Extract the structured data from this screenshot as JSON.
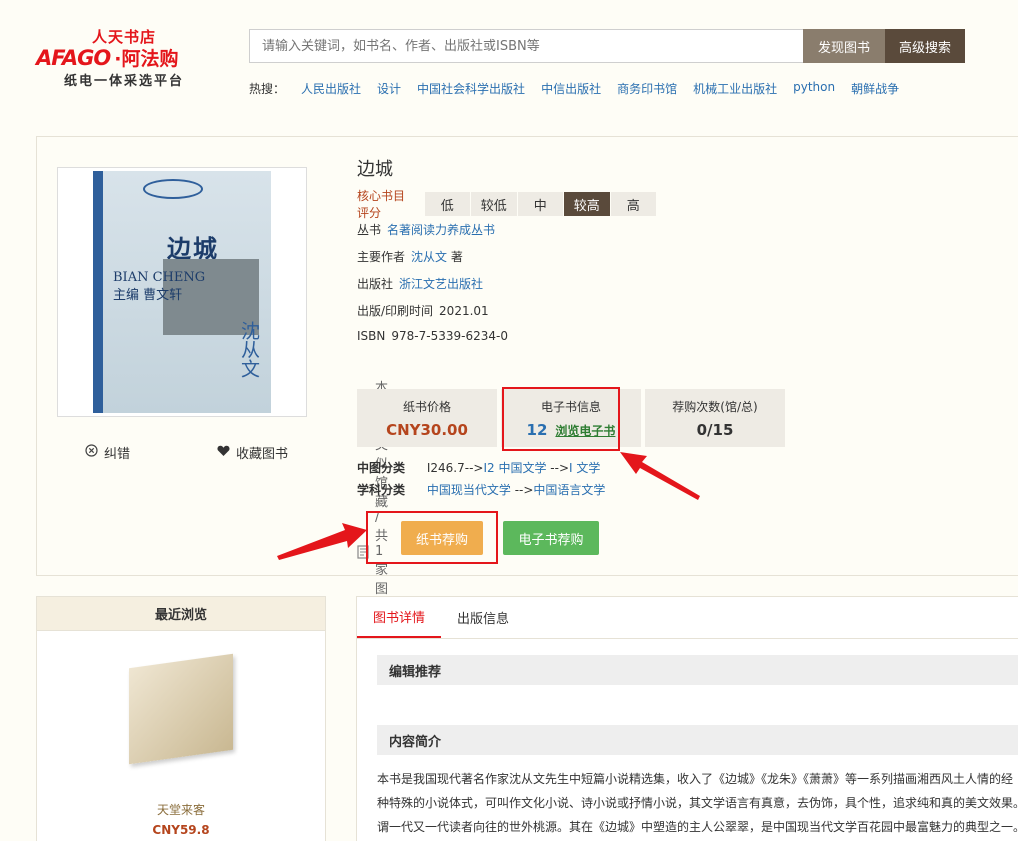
{
  "logo": {
    "store": "人天书店",
    "brand": "AFAGO",
    "brand_cn": "·阿法购",
    "slogan": "纸电一体采选平台"
  },
  "search": {
    "placeholder": "请输入关键词，如书名、作者、出版社或ISBN等",
    "find_label": "发现图书",
    "advanced_label": "高级搜索"
  },
  "hot": {
    "label": "热搜：",
    "items": [
      "人民出版社",
      "设计",
      "中国社会科学出版社",
      "中信出版社",
      "商务印书馆",
      "机械工业出版社",
      "python",
      "朝鲜战争"
    ]
  },
  "book": {
    "title": "边城",
    "rating_label": "核心书目评分",
    "rating_options": [
      "低",
      "较低",
      "中",
      "较高",
      "高"
    ],
    "rating_selected": "较高",
    "series_label": "丛书",
    "series": "名著阅读力养成丛书",
    "author_label": "主要作者",
    "author": "沈从文",
    "author_role": "著",
    "publisher_label": "出版社",
    "publisher": "浙江文艺出版社",
    "date_label": "出版/印刷时间",
    "date": "2021.01",
    "isbn_label": "ISBN",
    "isbn": "978-7-5339-6234-0",
    "holding_text": "本馆无类似馆藏 / 共1家图书馆有类似馆藏",
    "cover": {
      "title": "边城",
      "sub": "BIAN CHENG",
      "editor": "主编 曹文轩",
      "author": "沈从文"
    }
  },
  "actions": {
    "report": "纠错",
    "favorite": "收藏图书"
  },
  "stats": {
    "paper_price_label": "纸书价格",
    "paper_price": "CNY30.00",
    "ebook_label": "电子书信息",
    "ebook_count": "12",
    "ebook_link": "浏览电子书",
    "order_label": "荐购次数(馆/总)",
    "order_value": "0/15"
  },
  "classification": {
    "clc_label": "中图分类",
    "clc": [
      "I246.7-->",
      "I2 中国文学",
      "-->",
      "I 文学"
    ],
    "subject_label": "学科分类",
    "subject": [
      "中国现当代文学",
      "-->",
      "中国语言文学"
    ]
  },
  "buttons": {
    "paper_order": "纸书荐购",
    "ebook_order": "电子书荐购"
  },
  "recent": {
    "title": "最近浏览",
    "item_name": "天堂来客",
    "item_price": "CNY59.8"
  },
  "details": {
    "tabs": [
      "图书详情",
      "出版信息"
    ],
    "editor_rec": "编辑推荐",
    "summary_title": "内容简介",
    "summary_lines": [
      "本书是我国现代著名作家沈从文先生中短篇小说精选集，收入了《边城》《龙朱》《萧萧》等一系列描画湘西风土人情的经",
      "种特殊的小说体式，可叫作文化小说、诗小说或抒情小说，其文学语言有真意，去伪饰，具个性，追求纯和真的美文效果。",
      "谓一代又一代读者向往的世外桃源。其在《边城》中塑造的主人公翠翠，是中国现当代文学百花园中最富魅力的典型之一。"
    ]
  }
}
